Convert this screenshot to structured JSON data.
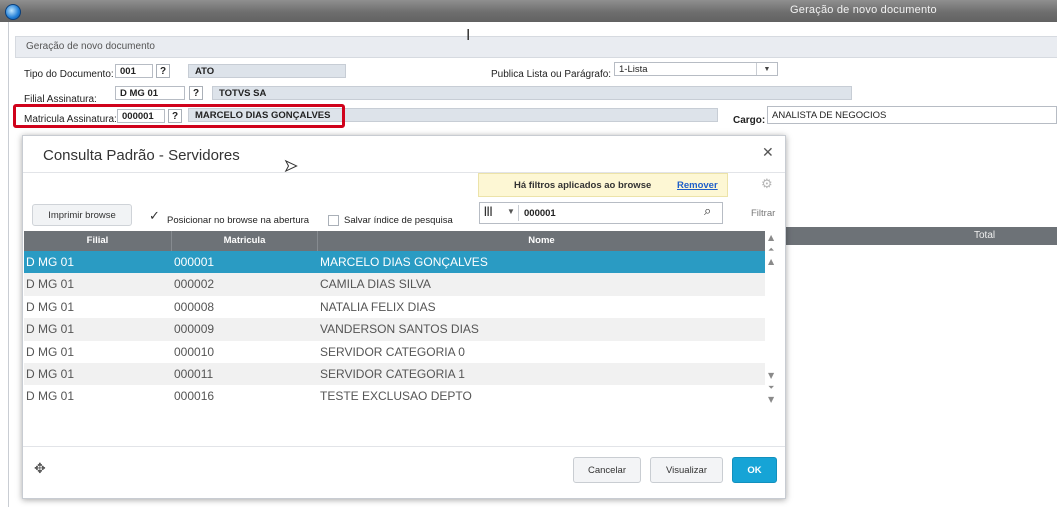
{
  "window": {
    "title": "Geração de novo documento"
  },
  "form": {
    "header": "Geração de novo documento",
    "tipo_label": "Tipo do Documento:",
    "tipo_code": "001",
    "tipo_desc": "ATO",
    "filial_label": "Filial Assinatura:",
    "filial_code": "D MG 01",
    "filial_desc": "TOTVS SA",
    "matricula_label": "Matricula Assinatura:",
    "matricula_code": "000001",
    "matricula_desc": "MARCELO DIAS GONÇALVES",
    "publica_label": "Publica Lista ou Parágrafo:",
    "publica_value": "1-Lista",
    "cargo_label": "Cargo:",
    "cargo_value": "ANALISTA DE NEGOCIOS",
    "lookup_button": "?",
    "grid_total_header": "Total"
  },
  "modal": {
    "title": "Consulta Padrão - Servidores",
    "filter_notice": "Há filtros aplicados ao browse",
    "filter_remove": "Remover",
    "print_button": "Imprimir browse",
    "position_checkbox": {
      "label": "Posicionar no browse na abertura",
      "checked": true
    },
    "save_index_checkbox": {
      "label": "Salvar índice de pesquisa",
      "checked": false
    },
    "search_value": "000001",
    "filter_button": "Filtrar",
    "columns": [
      "Filial",
      "Matricula",
      "Nome"
    ],
    "rows": [
      {
        "filial": "D MG 01",
        "matricula": "000001",
        "nome": "MARCELO DIAS GONÇALVES",
        "selected": true
      },
      {
        "filial": "D MG 01",
        "matricula": "000002",
        "nome": "CAMILA DIAS SILVA"
      },
      {
        "filial": "D MG 01",
        "matricula": "000008",
        "nome": "NATALIA FELIX DIAS"
      },
      {
        "filial": "D MG 01",
        "matricula": "000009",
        "nome": "VANDERSON SANTOS DIAS"
      },
      {
        "filial": "D MG 01",
        "matricula": "000010",
        "nome": "SERVIDOR CATEGORIA 0"
      },
      {
        "filial": "D MG 01",
        "matricula": "000011",
        "nome": "SERVIDOR CATEGORIA 1"
      },
      {
        "filial": "D MG 01",
        "matricula": "000016",
        "nome": "TESTE EXCLUSAO DEPTO"
      }
    ],
    "buttons": {
      "cancel": "Cancelar",
      "view": "Visualizar",
      "ok": "OK"
    }
  },
  "colors": {
    "selected_row": "#2a9bc3",
    "ok_button": "#16a4d6",
    "highlight": "#d0021b",
    "header_bg": "#6d7277"
  },
  "icons": {
    "close": "close-icon",
    "settings": "gear-icon",
    "search": "search-icon",
    "move": "move-icon",
    "columns": "columns-icon"
  }
}
